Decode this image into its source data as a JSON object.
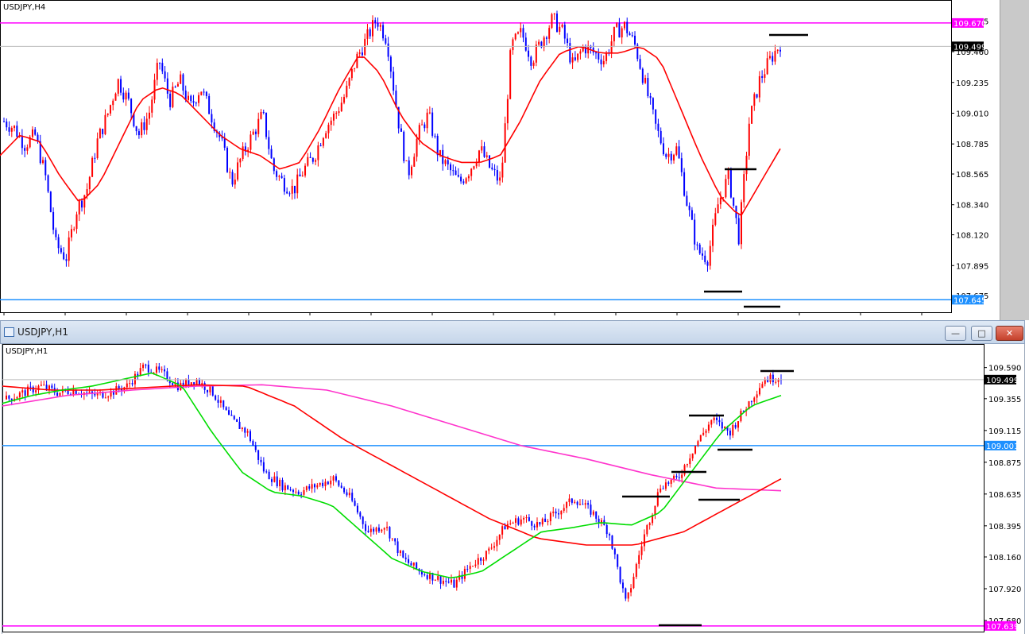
{
  "window_title": "USDJPY,H1",
  "window_buttons": {
    "minimize": "—",
    "maximize": "□",
    "close": "✕"
  },
  "colors": {
    "bull": "#ff0000",
    "bear": "#0000ff",
    "ma_red": "#ff0000",
    "ma_green": "#00dd00",
    "ma_magenta": "#ff33cc",
    "level_magenta": "#ff00ff",
    "level_blue": "#1e90ff",
    "marker": "#000000"
  },
  "chart_data": [
    {
      "type": "candlestick",
      "title": "USDJPY,H4",
      "ylim": [
        107.6,
        109.78
      ],
      "y_ticks": [
        "109.685",
        "109.460",
        "109.235",
        "109.010",
        "108.785",
        "108.565",
        "108.340",
        "108.120",
        "107.895",
        "107.675"
      ],
      "current_price": "109.499",
      "level_labels": [
        {
          "value": "109.670",
          "color": "magenta"
        },
        {
          "value": "107.645",
          "color": "blue"
        }
      ],
      "ohlc_path": [
        108.95,
        108.9,
        108.78,
        108.85,
        108.55,
        108.05,
        107.95,
        108.3,
        108.45,
        108.8,
        109.0,
        109.25,
        109.1,
        108.85,
        109.0,
        109.4,
        109.1,
        109.25,
        109.05,
        109.2,
        109.0,
        108.8,
        108.5,
        108.7,
        108.85,
        109.0,
        108.6,
        108.5,
        108.45,
        108.6,
        108.7,
        108.9,
        109.0,
        109.15,
        109.4,
        109.55,
        109.7,
        109.55,
        109.0,
        108.55,
        108.85,
        109.0,
        108.7,
        108.6,
        108.5,
        108.6,
        108.75,
        108.6,
        108.5,
        109.5,
        109.6,
        109.4,
        109.55,
        109.7,
        109.6,
        109.35,
        109.5,
        109.45,
        109.4,
        109.6,
        109.65,
        109.5,
        109.2,
        108.9,
        108.7,
        108.75,
        108.35,
        108.0,
        107.95,
        108.35,
        108.55,
        108.1,
        108.95,
        109.25,
        109.4,
        109.52
      ],
      "ma_red_path": [
        108.7,
        108.85,
        108.8,
        108.55,
        108.35,
        108.5,
        108.8,
        109.1,
        109.2,
        109.15,
        109.0,
        108.85,
        108.75,
        108.7,
        108.6,
        108.65,
        108.9,
        109.2,
        109.45,
        109.3,
        109.0,
        108.8,
        108.7,
        108.65,
        108.65,
        108.7,
        108.95,
        109.25,
        109.45,
        109.5,
        109.45,
        109.45,
        109.5,
        109.4,
        109.05,
        108.7,
        108.4,
        108.25,
        108.5,
        108.75
      ]
    },
    {
      "type": "candlestick",
      "title": "USDJPY,H1",
      "ylim": [
        107.62,
        109.72
      ],
      "y_ticks": [
        "109.590",
        "109.355",
        "109.115",
        "108.875",
        "108.635",
        "108.395",
        "108.160",
        "107.920",
        "107.680"
      ],
      "current_price": "109.499",
      "level_labels": [
        {
          "value": "109.001",
          "color": "blue"
        },
        {
          "value": "107.639",
          "color": "magenta"
        }
      ],
      "ohlc_path": [
        109.35,
        109.4,
        109.45,
        109.4,
        109.42,
        109.38,
        109.4,
        109.45,
        109.6,
        109.55,
        109.45,
        109.5,
        109.4,
        109.2,
        109.1,
        108.8,
        108.7,
        108.65,
        108.7,
        108.75,
        108.6,
        108.35,
        108.4,
        108.15,
        108.05,
        108.0,
        107.95,
        108.1,
        108.2,
        108.4,
        108.45,
        108.4,
        108.5,
        108.6,
        108.5,
        108.35,
        107.8,
        108.3,
        108.7,
        108.75,
        109.0,
        109.2,
        109.1,
        109.3,
        109.5,
        109.52
      ],
      "ma_green_path": [
        109.32,
        109.38,
        109.42,
        109.45,
        109.5,
        109.55,
        109.45,
        109.1,
        108.8,
        108.65,
        108.62,
        108.55,
        108.35,
        108.15,
        108.05,
        108.0,
        108.05,
        108.2,
        108.35,
        108.38,
        108.42,
        108.4,
        108.5,
        108.8,
        109.1,
        109.3,
        109.38
      ],
      "ma_red_path": [
        109.45,
        109.42,
        109.42,
        109.44,
        109.46,
        109.45,
        109.3,
        109.05,
        108.85,
        108.65,
        108.45,
        108.3,
        108.25,
        108.25,
        108.35,
        108.55,
        108.75
      ],
      "ma_magenta_path": [
        109.3,
        109.38,
        109.42,
        109.45,
        109.46,
        109.42,
        109.3,
        109.15,
        109.0,
        108.9,
        108.78,
        108.68,
        108.66
      ]
    }
  ]
}
